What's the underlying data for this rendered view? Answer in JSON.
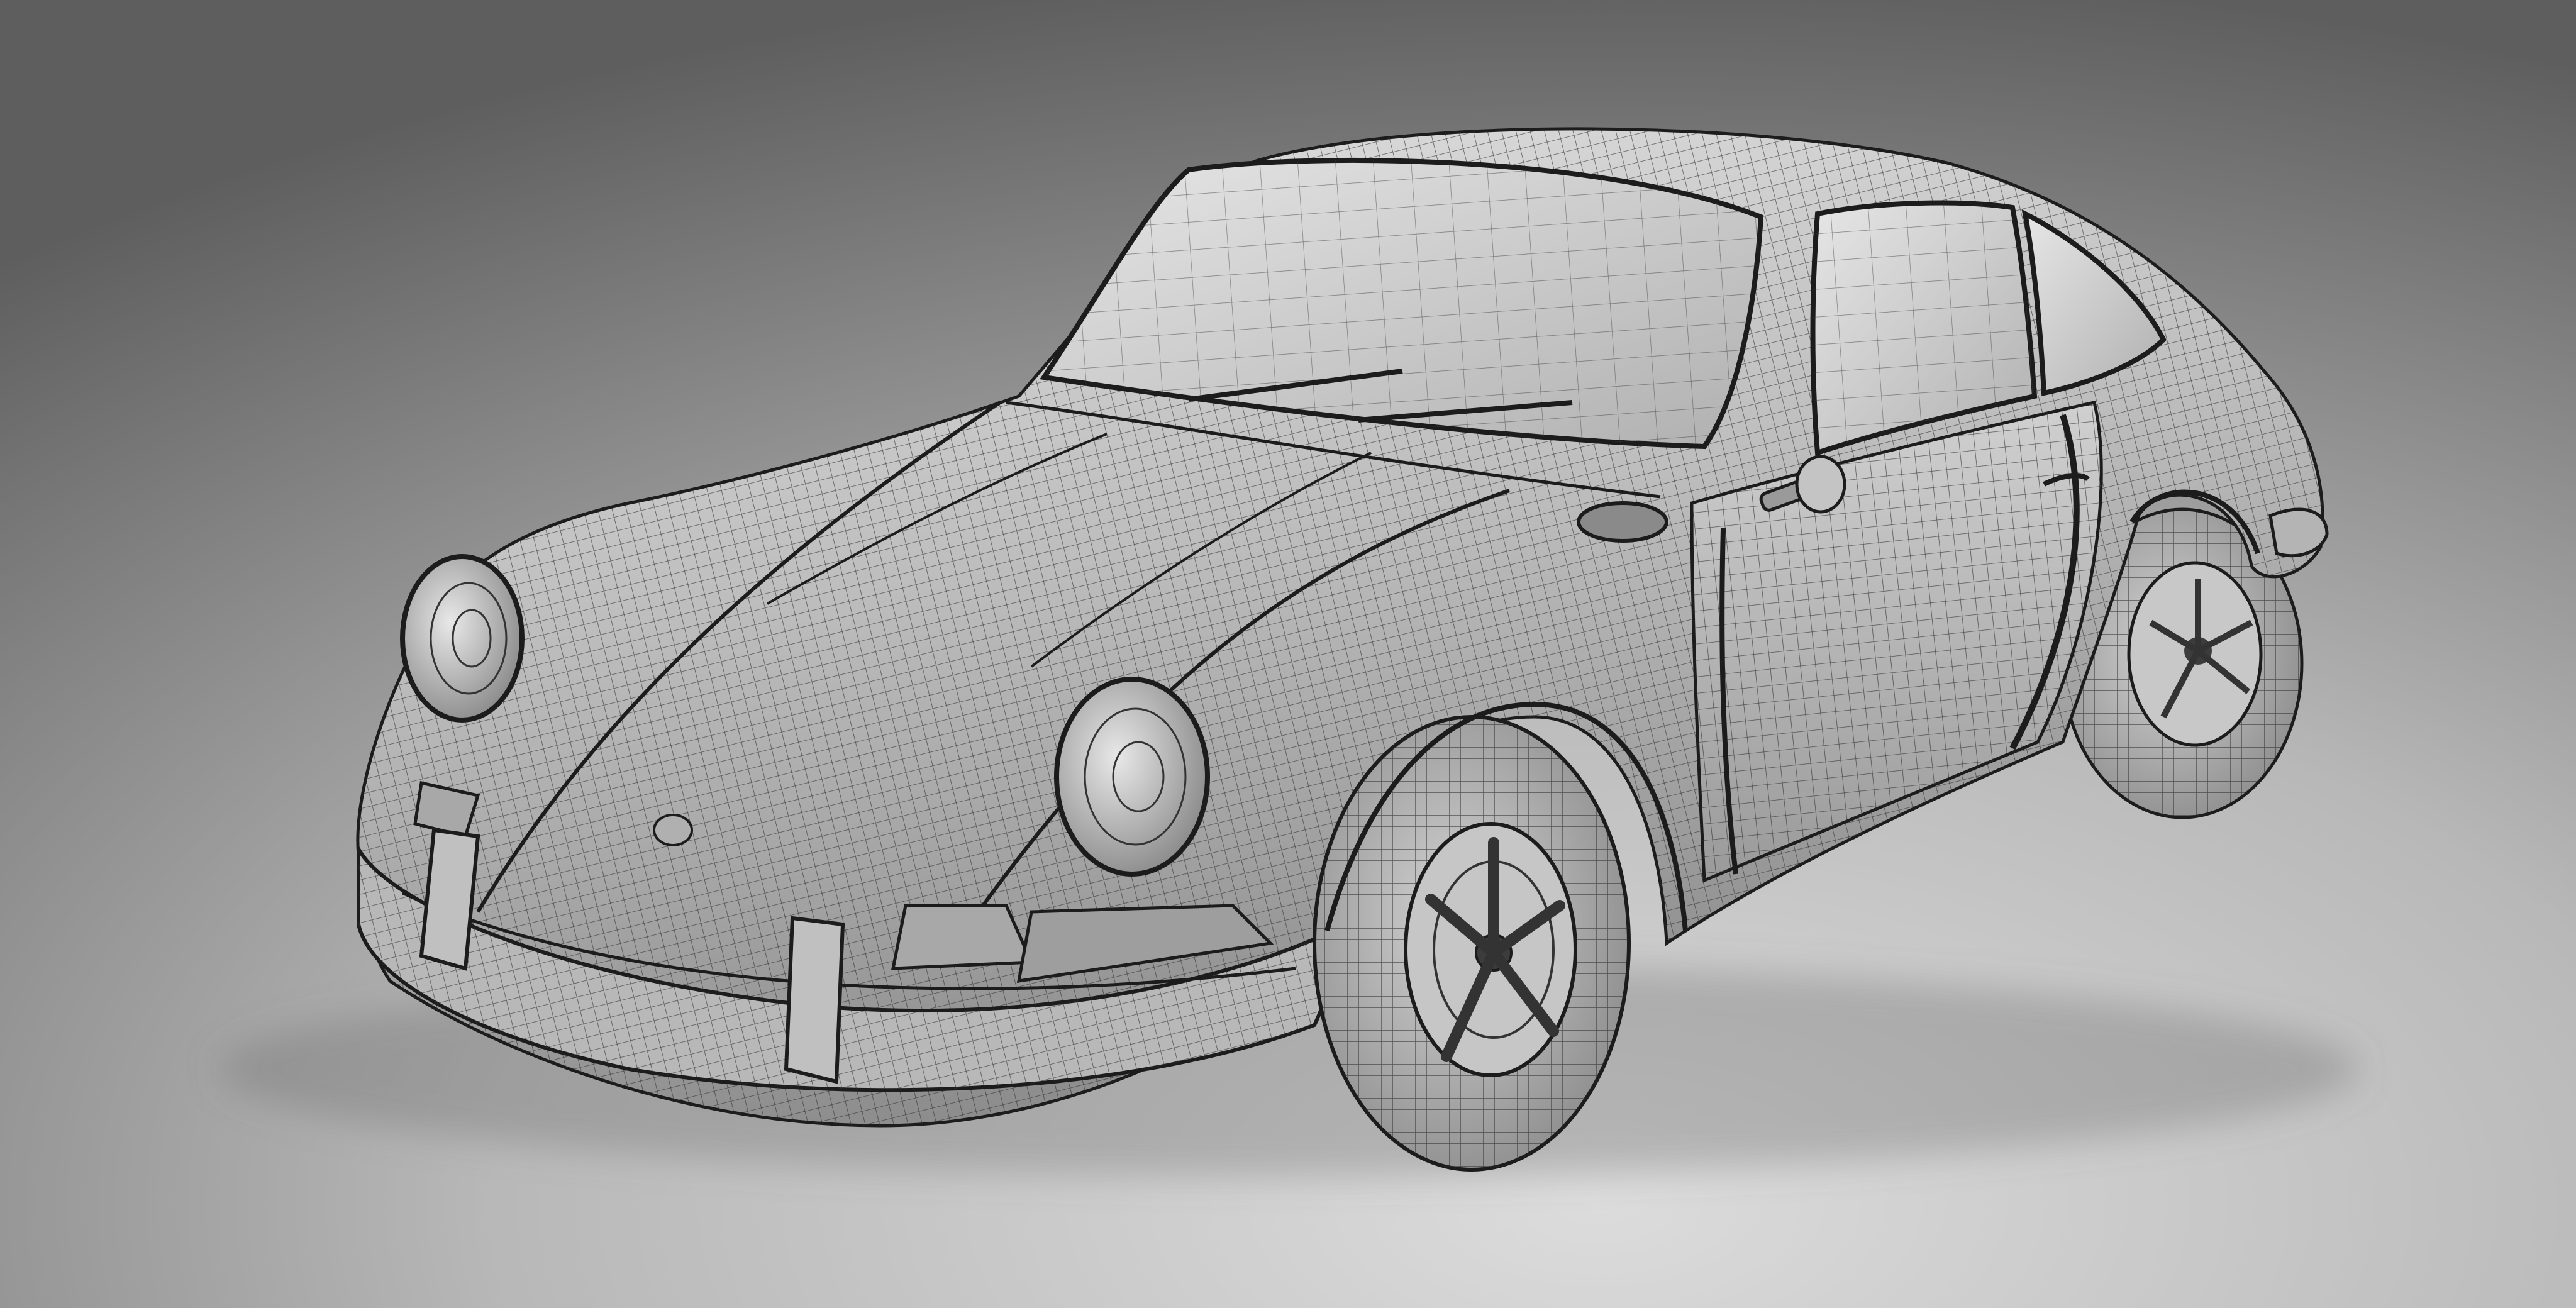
{
  "scene": {
    "subject": "classic-coupe-wireframe-render",
    "render_style": "clay-render-with-quad-mesh-wireframe",
    "colors": {
      "background_dark": "#6a6a6a",
      "background_mid": "#a8a8a8",
      "background_light": "#d6d6d6",
      "body_light": "#d8d8d8",
      "body_mid": "#b4b4b4",
      "body_shadow": "#8a8a8a",
      "wire": "#3a3a3a",
      "edge": "#1c1c1c",
      "glass": "#c9c9c9",
      "tire": "#b9b9b9",
      "rim_dark": "#3c3c3c"
    }
  }
}
